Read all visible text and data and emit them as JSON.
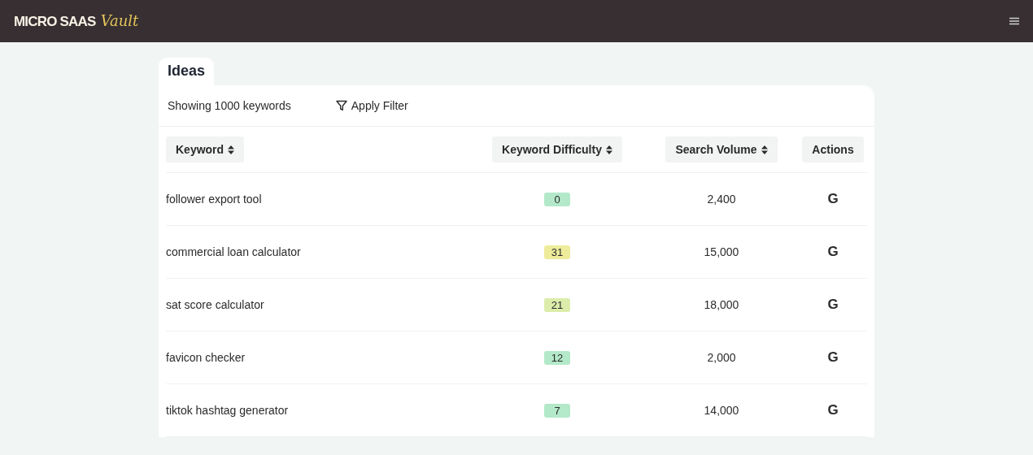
{
  "brand": {
    "name": "MICRO SAAS",
    "accent": "Vault"
  },
  "tab": {
    "label": "Ideas",
    "selected": true
  },
  "toolbar": {
    "count_text": "Showing 1000 keywords",
    "filter_button": "Apply Filter"
  },
  "table": {
    "columns": [
      {
        "label": "Keyword",
        "sortable": true
      },
      {
        "label": "Keyword Difficulty",
        "sortable": true
      },
      {
        "label": "Search Volume",
        "sortable": true
      },
      {
        "label": "Actions",
        "sortable": false
      }
    ],
    "rows": [
      {
        "keyword": "follower export tool",
        "difficulty": "0",
        "color": "#b3e9c9",
        "volume": "2,400",
        "action": "G"
      },
      {
        "keyword": "commercial loan calculator",
        "difficulty": "31",
        "color": "#eeec9a",
        "volume": "15,000",
        "action": "G"
      },
      {
        "keyword": "sat score calculator",
        "difficulty": "21",
        "color": "#dcedab",
        "volume": "18,000",
        "action": "G"
      },
      {
        "keyword": "favicon checker",
        "difficulty": "12",
        "color": "#b3e9c9",
        "volume": "2,000",
        "action": "G"
      },
      {
        "keyword": "tiktok hashtag generator",
        "difficulty": "7",
        "color": "#b3e9c9",
        "volume": "14,000",
        "action": "G"
      }
    ]
  }
}
